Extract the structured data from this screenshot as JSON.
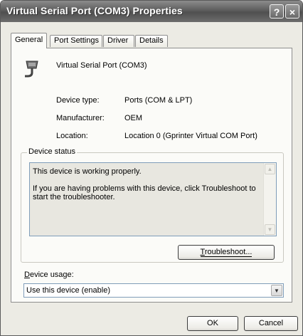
{
  "window": {
    "title": "Virtual Serial Port (COM3) Properties",
    "help_glyph": "?",
    "close_glyph": "×"
  },
  "tabs": [
    {
      "label": "General",
      "active": true
    },
    {
      "label": "Port Settings",
      "active": false
    },
    {
      "label": "Driver",
      "active": false
    },
    {
      "label": "Details",
      "active": false
    }
  ],
  "device": {
    "name": "Virtual Serial Port (COM3)",
    "icon": "serial-port-icon",
    "fields": [
      {
        "label": "Device type:",
        "value": "Ports (COM & LPT)"
      },
      {
        "label": "Manufacturer:",
        "value": "OEM"
      },
      {
        "label": "Location:",
        "value": "Location 0 (Gprinter Virtual COM Port)"
      }
    ]
  },
  "status": {
    "group_label": "Device status",
    "text": "This device is working properly.\n\nIf you are having problems with this device, click Troubleshoot to\nstart the troubleshooter.",
    "troubleshoot_accel": "T",
    "troubleshoot_rest": "roubleshoot..."
  },
  "usage": {
    "label_accel": "D",
    "label_rest": "evice usage:",
    "selected": "Use this device (enable)"
  },
  "footer": {
    "ok": "OK",
    "cancel": "Cancel"
  }
}
